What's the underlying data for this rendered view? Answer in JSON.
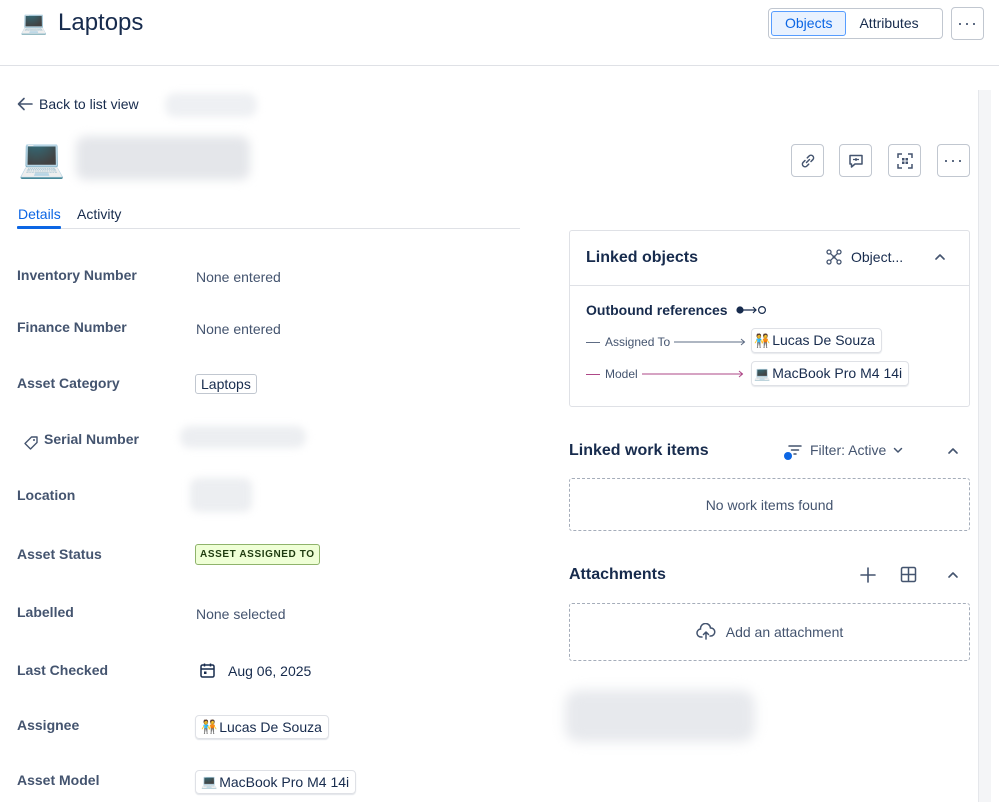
{
  "header": {
    "title": "Laptops",
    "icon": "laptop-icon",
    "view_toggle": {
      "objects_label": "Objects",
      "attributes_label": "Attributes",
      "selected": "Objects"
    },
    "more_label": "···"
  },
  "nav": {
    "back_label": "Back to list view"
  },
  "object": {
    "icon": "laptop-icon"
  },
  "tabs": [
    {
      "label": "Details",
      "active": true
    },
    {
      "label": "Activity",
      "active": false
    }
  ],
  "fields": {
    "inventory_number": {
      "label": "Inventory Number",
      "value": "None entered"
    },
    "finance_number": {
      "label": "Finance Number",
      "value": "None entered"
    },
    "asset_category": {
      "label": "Asset Category",
      "value": "Laptops"
    },
    "serial_number": {
      "label": "Serial Number"
    },
    "location": {
      "label": "Location"
    },
    "asset_status": {
      "label": "Asset Status",
      "value": "ASSET ASSIGNED TO",
      "color": "#efffd6"
    },
    "labelled": {
      "label": "Labelled",
      "value": "None selected"
    },
    "last_checked": {
      "label": "Last Checked",
      "value": "Aug 06, 2025"
    },
    "assignee": {
      "label": "Assignee",
      "value": "Lucas De Souza",
      "icon": "people-emoji-icon"
    },
    "asset_model": {
      "label": "Asset Model",
      "value": "MacBook Pro M4 14i",
      "icon": "laptop-icon"
    }
  },
  "linked_objects": {
    "title": "Linked objects",
    "objects_label": "Object...",
    "outbound_title": "Outbound references",
    "references": [
      {
        "label": "Assigned To",
        "target": "Lucas De Souza",
        "color": "#5e6c84"
      },
      {
        "label": "Model",
        "target": "MacBook Pro M4 14i",
        "color": "#ae4787"
      }
    ]
  },
  "work_items": {
    "title": "Linked work items",
    "filter_label": "Filter: Active",
    "empty_text": "No work items found"
  },
  "attachments": {
    "title": "Attachments",
    "add_label": "Add an attachment"
  },
  "colors": {
    "accent": "#0c66e4"
  }
}
